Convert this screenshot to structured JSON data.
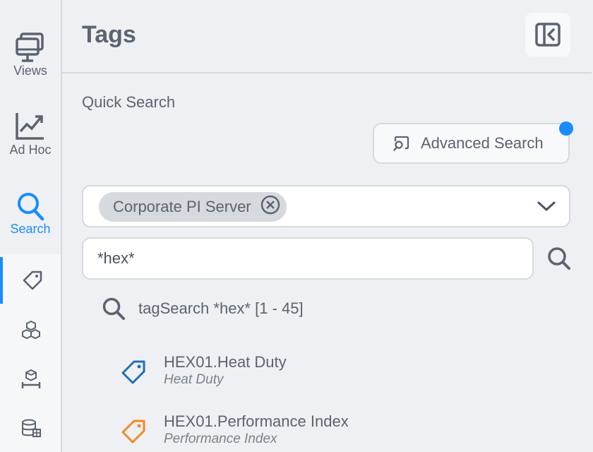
{
  "rail": {
    "items": [
      {
        "label": "Views",
        "icon": "monitor-icon"
      },
      {
        "label": "Ad Hoc",
        "icon": "trend-chart-icon"
      },
      {
        "label": "Search",
        "icon": "search-icon",
        "active": true
      }
    ],
    "sub_items": [
      {
        "icon": "tag-icon",
        "active": true
      },
      {
        "icon": "cubes-icon"
      },
      {
        "icon": "asset-box-icon"
      },
      {
        "icon": "database-icon"
      }
    ]
  },
  "header": {
    "title": "Tags",
    "collapse_icon": "collapse-panel-icon"
  },
  "quick_search": {
    "label": "Quick Search",
    "advanced_label": "Advanced Search",
    "server_chip": "Corporate PI Server",
    "query_value": "*hex*",
    "summary": "tagSearch *hex* [1 - 45]"
  },
  "results": [
    {
      "name": "HEX01.Heat Duty",
      "description": "Heat Duty",
      "color": "#1f6fb2"
    },
    {
      "name": "HEX01.Performance Index",
      "description": "Performance Index",
      "color": "#f08a24"
    }
  ],
  "colors": {
    "accent": "#1a8cff",
    "background": "#eef0f3"
  }
}
